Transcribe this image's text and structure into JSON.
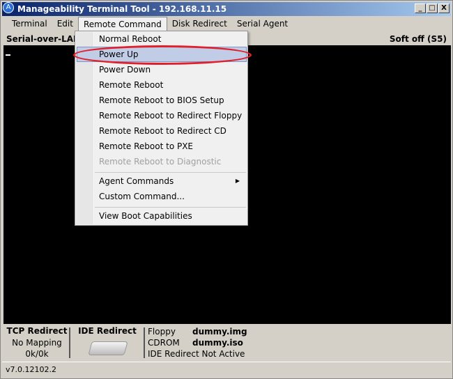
{
  "window": {
    "title": "Manageability Terminal Tool - 192.168.11.15",
    "icon_letter": "A",
    "min": "_",
    "max": "□",
    "close": "X"
  },
  "menubar": [
    "Terminal",
    "Edit",
    "Remote Command",
    "Disk Redirect",
    "Serial Agent"
  ],
  "status": {
    "left": "Serial-over-LAN -",
    "right": "Soft off (S5)"
  },
  "dropdown": {
    "items": [
      {
        "label": "Normal Reboot",
        "state": "normal"
      },
      {
        "label": "Power Up",
        "state": "highlighted"
      },
      {
        "label": "Power Down",
        "state": "normal"
      },
      {
        "label": "Remote Reboot",
        "state": "normal"
      },
      {
        "label": "Remote Reboot to BIOS Setup",
        "state": "normal"
      },
      {
        "label": "Remote Reboot to Redirect Floppy",
        "state": "normal"
      },
      {
        "label": "Remote Reboot to Redirect CD",
        "state": "normal"
      },
      {
        "label": "Remote Reboot to PXE",
        "state": "normal"
      },
      {
        "label": "Remote Reboot to Diagnostic",
        "state": "disabled"
      },
      {
        "label": "Agent Commands",
        "state": "submenu"
      },
      {
        "label": "Custom Command...",
        "state": "normal"
      },
      {
        "label": "View Boot Capabilities",
        "state": "normal"
      }
    ]
  },
  "tcp": {
    "title": "TCP Redirect",
    "mapping": "No Mapping",
    "rate": "0k/0k"
  },
  "ide": {
    "title": "IDE Redirect",
    "floppy_label": "Floppy",
    "floppy": "dummy.img",
    "cdrom_label": "CDROM",
    "cdrom": "dummy.iso",
    "state": "IDE Redirect Not Active"
  },
  "version": "v7.0.12102.2",
  "colors": {
    "highlight": "#c1cde6",
    "annotation": "#e0202a"
  }
}
